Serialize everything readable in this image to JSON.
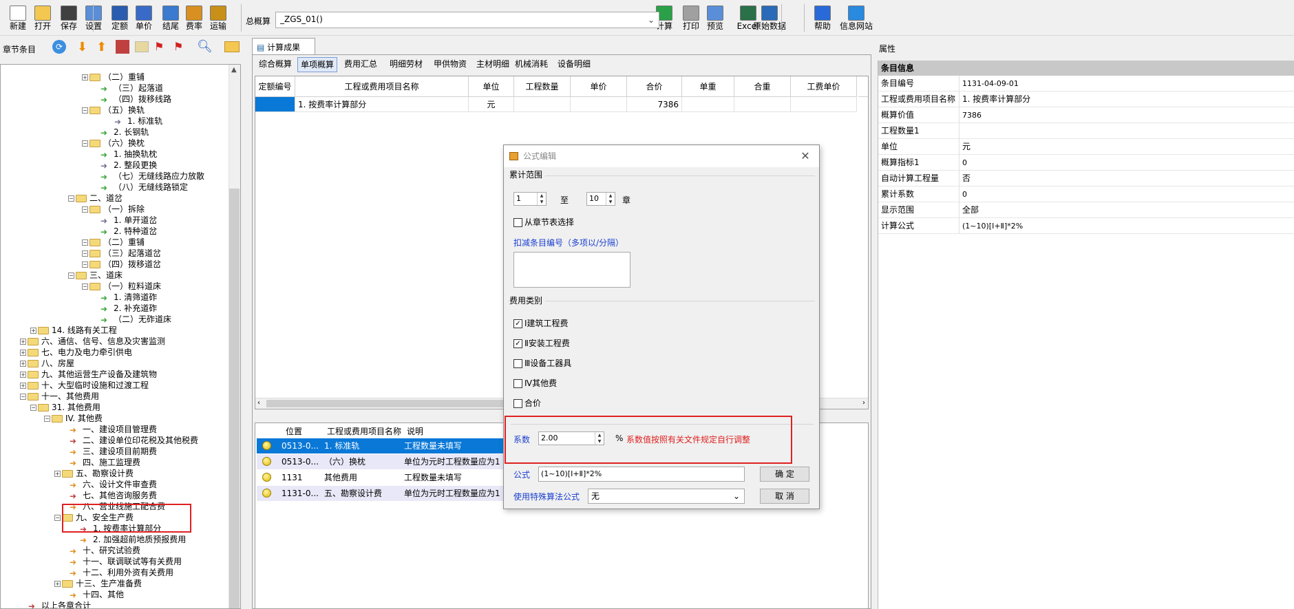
{
  "toolbar": {
    "buttons": [
      {
        "label": "新建",
        "icon": "new-file-icon"
      },
      {
        "label": "打开",
        "icon": "open-folder-icon"
      },
      {
        "label": "保存",
        "icon": "save-disk-icon"
      },
      {
        "label": "设置",
        "icon": "settings-icon"
      },
      {
        "label": "定额",
        "icon": "quota-icon"
      },
      {
        "label": "单价",
        "icon": "unit-price-icon"
      },
      {
        "label": "结尾",
        "icon": "ending-icon"
      },
      {
        "label": "费率",
        "icon": "fee-rate-icon"
      },
      {
        "label": "运输",
        "icon": "transport-icon"
      },
      {
        "label": "计算",
        "icon": "calculate-icon"
      },
      {
        "label": "打印",
        "icon": "print-icon"
      },
      {
        "label": "预览",
        "icon": "preview-icon"
      },
      {
        "label": "Excel",
        "icon": "excel-icon"
      },
      {
        "label": "原始数据",
        "icon": "raw-data-icon"
      },
      {
        "label": "帮助",
        "icon": "help-icon"
      },
      {
        "label": "信息网站",
        "icon": "info-website-icon"
      }
    ],
    "project_label": "总概算",
    "project_value": "_ZGS_01()"
  },
  "left": {
    "title": "章节条目",
    "tree": [
      {
        "text": "（二）重铺",
        "kind": "folder"
      },
      {
        "text": "（三）起落道",
        "kind": "arrow-g"
      },
      {
        "text": "（四）拨移线路",
        "kind": "arrow-g"
      },
      {
        "text": "（五）换轨",
        "kind": "folder"
      },
      {
        "text": "1. 标准轨",
        "kind": "arrow-p"
      },
      {
        "text": "2. 长钢轨",
        "kind": "arrow-g"
      },
      {
        "text": "（六）换枕",
        "kind": "folder"
      },
      {
        "text": "1. 抽换轨枕",
        "kind": "arrow-g"
      },
      {
        "text": "2. 整段更换",
        "kind": "arrow-p"
      },
      {
        "text": "（七）无缝线路应力放散",
        "kind": "arrow-g"
      },
      {
        "text": "（八）无缝线路锁定",
        "kind": "arrow-g"
      },
      {
        "text": "二、道岔",
        "kind": "folder"
      },
      {
        "text": "（一）拆除",
        "kind": "folder"
      },
      {
        "text": "1. 单开道岔",
        "kind": "arrow-p"
      },
      {
        "text": "2. 特种道岔",
        "kind": "arrow-g"
      },
      {
        "text": "（二）重铺",
        "kind": "folder"
      },
      {
        "text": "（三）起落道岔",
        "kind": "folder"
      },
      {
        "text": "（四）拨移道岔",
        "kind": "folder"
      },
      {
        "text": "三、道床",
        "kind": "folder"
      },
      {
        "text": "（一）粒料道床",
        "kind": "folder"
      },
      {
        "text": "1. 清筛道砟",
        "kind": "arrow-g"
      },
      {
        "text": "2. 补充道砟",
        "kind": "arrow-g"
      },
      {
        "text": "（二）无砟道床",
        "kind": "arrow-g"
      },
      {
        "text": "14. 线路有关工程",
        "kind": "folder"
      },
      {
        "text": "六、通信、信号、信息及灾害监测",
        "kind": "folder"
      },
      {
        "text": "七、电力及电力牵引供电",
        "kind": "folder"
      },
      {
        "text": "八、房屋",
        "kind": "folder"
      },
      {
        "text": "九、其他运营生产设备及建筑物",
        "kind": "folder"
      },
      {
        "text": "十、大型临时设施和过渡工程",
        "kind": "folder"
      },
      {
        "text": "十一、其他费用",
        "kind": "folder"
      },
      {
        "text": "31. 其他费用",
        "kind": "folder"
      },
      {
        "text": "IV. 其他费",
        "kind": "folder"
      },
      {
        "text": "一、建设项目管理费",
        "kind": "arrow-o"
      },
      {
        "text": "二、建设单位印花税及其他税费",
        "kind": "arrow-r"
      },
      {
        "text": "三、建设项目前期费",
        "kind": "arrow-o"
      },
      {
        "text": "四、施工监理费",
        "kind": "arrow-o"
      },
      {
        "text": "五、勘察设计费",
        "kind": "folder"
      },
      {
        "text": "六、设计文件审查费",
        "kind": "arrow-o"
      },
      {
        "text": "七、其他咨询服务费",
        "kind": "arrow-r"
      },
      {
        "text": "八、营业线施工配合费",
        "kind": "arrow-o"
      },
      {
        "text": "九、安全生产费",
        "kind": "folder"
      },
      {
        "text": "1. 按费率计算部分",
        "kind": "arrow-r"
      },
      {
        "text": "2. 加强超前地质预报费用",
        "kind": "arrow-o"
      },
      {
        "text": "十、研究试验费",
        "kind": "arrow-o"
      },
      {
        "text": "十一、联调联试等有关费用",
        "kind": "arrow-o"
      },
      {
        "text": "十二、利用外资有关费用",
        "kind": "arrow-o"
      },
      {
        "text": "十三、生产准备费",
        "kind": "folder"
      },
      {
        "text": "十四、其他",
        "kind": "arrow-o"
      },
      {
        "text": "以上各章合计",
        "kind": "arrow-r"
      }
    ]
  },
  "main": {
    "tab": "计算成果",
    "subtabs": [
      "综合概算",
      "单项概算",
      "费用汇总",
      "明细劳材",
      "甲供物资",
      "主材明细",
      "机械消耗",
      "设备明细"
    ],
    "columns": [
      "定额编号",
      "工程或费用项目名称",
      "单位",
      "工程数量",
      "单价",
      "合价",
      "单重",
      "合重",
      "工费单价"
    ],
    "rows": [
      {
        "code": "",
        "name": "1. 按费率计算部分",
        "unit": "元",
        "qty": "",
        "price": "",
        "total": "7386"
      }
    ],
    "bottom_columns": [
      "位置",
      "工程或费用项目名称",
      "说明"
    ],
    "bottom_rows": [
      {
        "pos": "0513-0...",
        "name": "1. 标准轨",
        "note": "工程数量未填写"
      },
      {
        "pos": "0513-0...",
        "name": "（六）换枕",
        "note": "单位为元时工程数量应为1"
      },
      {
        "pos": "1131",
        "name": "其他费用",
        "note": "工程数量未填写"
      },
      {
        "pos": "1131-0...",
        "name": "五、勘察设计费",
        "note": "单位为元时工程数量应为1"
      }
    ]
  },
  "attributes": {
    "panel_title": "属性",
    "header": "条目信息",
    "rows": [
      {
        "k": "条目编号",
        "v": "1131-04-09-01"
      },
      {
        "k": "工程或费用项目名称",
        "v": "1. 按费率计算部分"
      },
      {
        "k": "概算价值",
        "v": "7386"
      },
      {
        "k": "工程数量1",
        "v": ""
      },
      {
        "k": "单位",
        "v": "元"
      },
      {
        "k": "概算指标1",
        "v": "0"
      },
      {
        "k": "自动计算工程量",
        "v": "否"
      },
      {
        "k": "累计系数",
        "v": "0"
      },
      {
        "k": "显示范围",
        "v": "全部"
      },
      {
        "k": "计算公式",
        "v": "(1~10)[Ⅰ+Ⅱ]*2%"
      }
    ]
  },
  "dialog": {
    "title": "公式编辑",
    "range_group": "累计范围",
    "from": "1",
    "to_label": "至",
    "to": "10",
    "chapter_label": "章",
    "from_chapter": "从章节表选择",
    "deduct_label": "扣减条目编号（多项以/分隔）",
    "fee_group": "费用类别",
    "fees": [
      {
        "label": "Ⅰ建筑工程费",
        "checked": true
      },
      {
        "label": "Ⅱ安装工程费",
        "checked": true
      },
      {
        "label": "Ⅲ设备工器具",
        "checked": false
      },
      {
        "label": "Ⅳ其他费",
        "checked": false
      },
      {
        "label": "合价",
        "checked": false
      }
    ],
    "coef_label": "系数",
    "coef_value": "2.00",
    "percent": "%",
    "coef_hint": "系数值按照有关文件规定自行调整",
    "formula_label": "公式",
    "formula_value": "(1~10)[Ⅰ+Ⅱ]*2%",
    "ok": "确 定",
    "cancel": "取 消",
    "special_label": "使用特殊算法公式",
    "special_value": "无"
  },
  "colors": {
    "highlight_red": "#e02020",
    "link_blue": "#1a3fd0",
    "select_blue": "#0a78d7"
  }
}
